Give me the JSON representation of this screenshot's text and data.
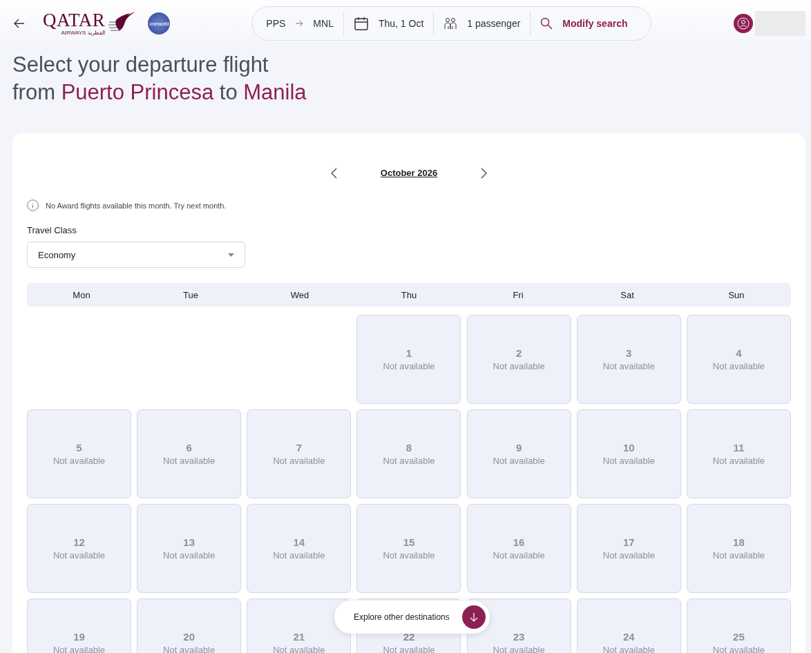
{
  "header": {
    "logo": {
      "wordmark": "QATAR",
      "subtitle": "AIRWAYS",
      "arabic": "القطرية"
    },
    "alliance_badge": "oneworld",
    "search_summary": {
      "origin": "PPS",
      "destination": "MNL",
      "date": "Thu, 1 Oct",
      "passengers": "1 passenger",
      "action": "Modify search"
    }
  },
  "heading": {
    "line_1": "Select your departure flight",
    "prefix": "from",
    "origin": "Puerto Princesa",
    "joiner": "to",
    "destination": "Manila"
  },
  "calendar": {
    "month": "October 2026",
    "notice": "No Award flights available this month. Try next month.",
    "travel_class": {
      "label": "Travel Class",
      "value": "Economy"
    },
    "weekdays": [
      "Mon",
      "Tue",
      "Wed",
      "Thu",
      "Fri",
      "Sat",
      "Sun"
    ],
    "weeks": [
      [
        {
          "kind": "blank"
        },
        {
          "kind": "blank"
        },
        {
          "kind": "blank"
        },
        {
          "kind": "day",
          "day": "1",
          "status": "Not available",
          "available": false
        },
        {
          "kind": "day",
          "day": "2",
          "status": "Not available",
          "available": false
        },
        {
          "kind": "day",
          "day": "3",
          "status": "Not available",
          "available": false
        },
        {
          "kind": "day",
          "day": "4",
          "status": "Not available",
          "available": false
        }
      ],
      [
        {
          "kind": "day",
          "day": "5",
          "status": "Not available",
          "available": false
        },
        {
          "kind": "day",
          "day": "6",
          "status": "Not available",
          "available": false
        },
        {
          "kind": "day",
          "day": "7",
          "status": "Not available",
          "available": false
        },
        {
          "kind": "day",
          "day": "8",
          "status": "Not available",
          "available": false
        },
        {
          "kind": "day",
          "day": "9",
          "status": "Not available",
          "available": false
        },
        {
          "kind": "day",
          "day": "10",
          "status": "Not available",
          "available": false
        },
        {
          "kind": "day",
          "day": "11",
          "status": "Not available",
          "available": false
        }
      ],
      [
        {
          "kind": "day",
          "day": "12",
          "status": "Not available",
          "available": false
        },
        {
          "kind": "day",
          "day": "13",
          "status": "Not available",
          "available": false
        },
        {
          "kind": "day",
          "day": "14",
          "status": "Not available",
          "available": false
        },
        {
          "kind": "day",
          "day": "15",
          "status": "Not available",
          "available": false
        },
        {
          "kind": "day",
          "day": "16",
          "status": "Not available",
          "available": false
        },
        {
          "kind": "day",
          "day": "17",
          "status": "Not available",
          "available": false
        },
        {
          "kind": "day",
          "day": "18",
          "status": "Not available",
          "available": false
        }
      ],
      [
        {
          "kind": "day",
          "day": "19",
          "status": "Not available",
          "available": false
        },
        {
          "kind": "day",
          "day": "20",
          "status": "Not available",
          "available": false
        },
        {
          "kind": "day",
          "day": "21",
          "status": "Not available",
          "available": false
        },
        {
          "kind": "day",
          "day": "22",
          "status": "Not available",
          "available": false
        },
        {
          "kind": "day",
          "day": "23",
          "status": "Not available",
          "available": false
        },
        {
          "kind": "day",
          "day": "24",
          "status": "Not available",
          "available": false
        },
        {
          "kind": "day",
          "day": "25",
          "status": "Not available",
          "available": false
        }
      ]
    ]
  },
  "floating_button": {
    "label": "Explore other destinations"
  }
}
